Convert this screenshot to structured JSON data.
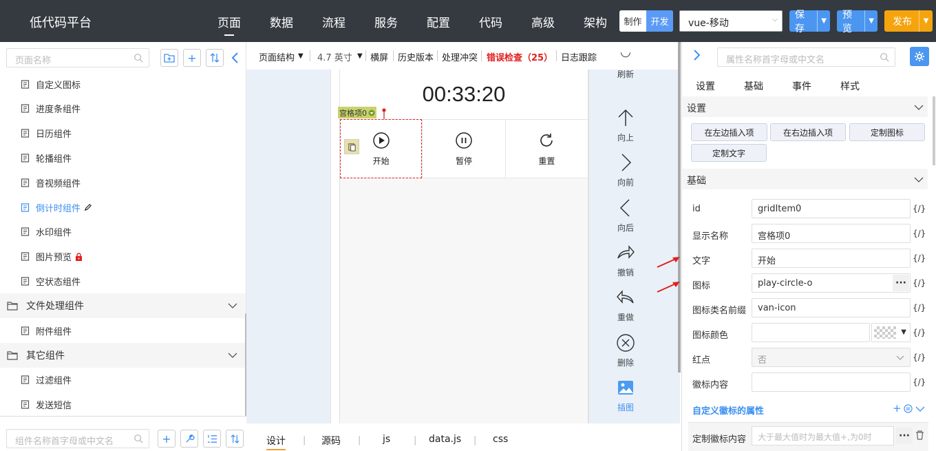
{
  "header": {
    "brand": "低代码平台",
    "nav": [
      "页面",
      "数据",
      "流程",
      "服务",
      "配置",
      "代码",
      "高级",
      "架构"
    ],
    "nav_active": "页面",
    "mode_make": "制作",
    "mode_dev": "开发",
    "framework": "vue-移动",
    "save": "保存",
    "preview": "预览",
    "publish": "发布",
    "colors": {
      "save": "#4b96f0",
      "preview": "#4b96f0",
      "publish": "#f5a40e",
      "bar": "#343a40",
      "accent": "#3b8ff0",
      "error": "#e02020"
    }
  },
  "left": {
    "page_search_placeholder": "页面名称",
    "items": [
      {
        "label": "自定义图标",
        "type": "leaf"
      },
      {
        "label": "进度条组件",
        "type": "leaf"
      },
      {
        "label": "日历组件",
        "type": "leaf"
      },
      {
        "label": "轮播组件",
        "type": "leaf"
      },
      {
        "label": "音视频组件",
        "type": "leaf"
      },
      {
        "label": "倒计时组件",
        "type": "leaf",
        "active": true,
        "badge": "edit-icon"
      },
      {
        "label": "水印组件",
        "type": "leaf"
      },
      {
        "label": "图片预览",
        "type": "leaf",
        "badge": "lock-icon"
      },
      {
        "label": "空状态组件",
        "type": "leaf"
      },
      {
        "label": "文件处理组件",
        "type": "group"
      },
      {
        "label": "附件组件",
        "type": "leaf"
      },
      {
        "label": "其它组件",
        "type": "group"
      },
      {
        "label": "过滤组件",
        "type": "leaf"
      },
      {
        "label": "发送短信",
        "type": "leaf"
      }
    ],
    "component_search_placeholder": "组件名称首字母或中文名"
  },
  "center": {
    "toolbar": {
      "structure": "页面结构",
      "size": "4.7 英寸",
      "landscape": "横屏",
      "history": "历史版本",
      "conflict": "处理冲突",
      "errors": "错误检查（25）",
      "logs": "日志跟踪"
    },
    "phone": {
      "timer": "00:33:20",
      "selected_tag": "宫格项0",
      "grid": [
        {
          "label": "开始",
          "icon": "play-circle-icon"
        },
        {
          "label": "暂停",
          "icon": "pause-circle-icon"
        },
        {
          "label": "重置",
          "icon": "replay-icon"
        }
      ]
    },
    "tools": [
      {
        "label": "刷新",
        "icon": "refresh-icon"
      },
      {
        "label": "向上",
        "icon": "arrow-up-icon"
      },
      {
        "label": "向前",
        "icon": "chevron-right-icon"
      },
      {
        "label": "向后",
        "icon": "chevron-left-icon"
      },
      {
        "label": "撤销",
        "icon": "undo-icon"
      },
      {
        "label": "重做",
        "icon": "redo-icon"
      },
      {
        "label": "删除",
        "icon": "delete-icon"
      },
      {
        "label": "插图",
        "icon": "image-icon"
      }
    ],
    "bottom_tabs": [
      "设计",
      "源码",
      "js",
      "data.js",
      "css"
    ],
    "bottom_active": "设计"
  },
  "right": {
    "search_placeholder": "属性名称首字母或中文名",
    "tabs": [
      "设置",
      "基础",
      "事件",
      "样式"
    ],
    "section_settings": "设置",
    "buttons": [
      "在左边插入项",
      "在右边插入项",
      "定制图标",
      "定制文字"
    ],
    "section_basic": "基础",
    "props": [
      {
        "label": "id",
        "value": "gridItem0"
      },
      {
        "label": "显示名称",
        "value": "宫格项0"
      },
      {
        "label": "文字",
        "value": "开始"
      },
      {
        "label": "图标",
        "value": "play-circle-o",
        "ellipsis": true
      },
      {
        "label": "图标类名前缀",
        "value": "van-icon"
      },
      {
        "label": "图标颜色",
        "value": "",
        "color": true
      },
      {
        "label": "红点",
        "value": "否",
        "select": true
      },
      {
        "label": "徽标内容",
        "value": ""
      }
    ],
    "code_mark": "{/}",
    "custom_badge_title": "自定义徽标的属性",
    "custom_badge_label": "定制徽标内容",
    "custom_badge_placeholder": "大于最大值时为最大值+,为0时"
  }
}
